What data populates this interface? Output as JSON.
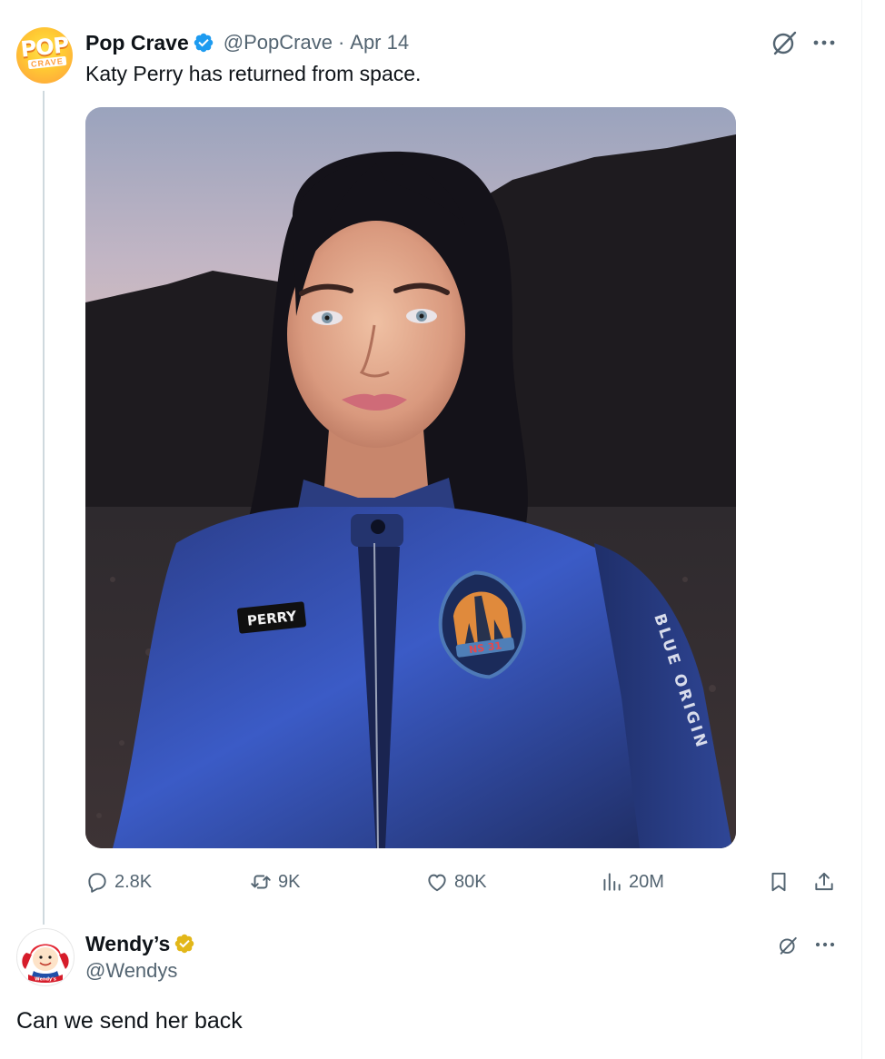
{
  "post1": {
    "display_name": "Pop Crave",
    "handle": "@PopCrave",
    "separator": "·",
    "date": "Apr 14",
    "text": "Katy Perry has returned from space.",
    "avatar": {
      "logo_top": "POP",
      "logo_bottom": "CRAVE"
    },
    "verified": "blue",
    "media": {
      "name_tag": "PERRY",
      "patch_text": "NS 31",
      "sleeve_text": "BLUE ORIGIN"
    },
    "actions": {
      "replies": "2.8K",
      "reposts": "9K",
      "likes": "80K",
      "views": "20M"
    }
  },
  "post2": {
    "display_name": "Wendy’s",
    "handle": "@Wendys",
    "verified": "gold",
    "text": "Can we send her back",
    "avatar": {
      "logo_text": "Wendy's"
    }
  },
  "icons": {
    "grok": "grok-icon",
    "more": "more-icon",
    "reply": "reply-icon",
    "repost": "repost-icon",
    "like": "heart-icon",
    "views": "views-icon",
    "bookmark": "bookmark-icon",
    "share": "share-icon"
  },
  "colors": {
    "text": "#0f1419",
    "muted": "#536471",
    "verified_blue": "#1d9bf0",
    "verified_gold": "#e2b719",
    "thread_line": "#cfd9de"
  }
}
